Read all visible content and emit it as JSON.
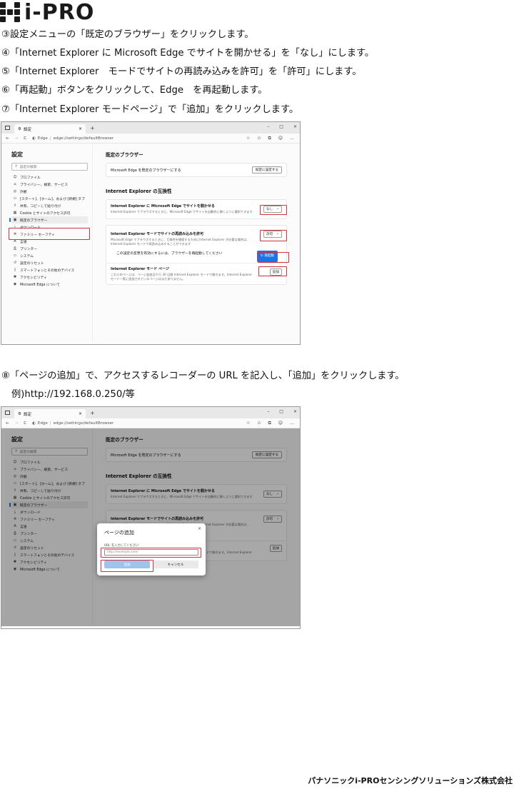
{
  "logo": {
    "text": "i-PRO"
  },
  "steps": {
    "s3": "③設定メニューの「既定のブラウザー」をクリックします。",
    "s4": "④「Internet Explorer に Microsoft Edge でサイトを開かせる」を「なし」にします。",
    "s5": "⑤「Internet Explorer　モードでサイトの再読み込みを許可」を「許可」にします。",
    "s6": "⑥「再起動」ボタンをクリックして、Edge　を再起動します。",
    "s7": "⑦「Internet Explorer モードページ」で「追加」をクリックします。",
    "s8": "⑧「ページの追加」で、アクセスするレコーダーの URL を記入し、「追加」をクリックします。",
    "example": "例)http://192.168.0.250/等"
  },
  "browser": {
    "tab_title": "設定",
    "tab_close": "×",
    "tab_plus": "+",
    "win_controls": [
      "–",
      "□",
      "×"
    ],
    "nav_back": "←",
    "nav_forward": "→",
    "nav_reload": "C",
    "edge_label": "Edge",
    "address_sep": "|",
    "address": "edge://settings/defaultBrowser",
    "toolbar_icons": [
      "☆",
      "✩",
      "⧉",
      "☺",
      "…"
    ]
  },
  "settings": {
    "sidebar_title": "設定",
    "search_placeholder": "設定の検索",
    "nav": [
      {
        "icon": "☺",
        "label": "プロファイル"
      },
      {
        "icon": "⌂",
        "label": "プライバシー、検索、サービス"
      },
      {
        "icon": "◎",
        "label": "外観"
      },
      {
        "icon": "▭",
        "label": "[スタート]、[ホーム]、および [新規] タブ"
      },
      {
        "icon": "⇪",
        "label": "共有、コピーして貼り付け"
      },
      {
        "icon": "▦",
        "label": "Cookie とサイトのアクセス許可"
      },
      {
        "icon": "▣",
        "label": "既定のブラウザー"
      },
      {
        "icon": "⤓",
        "label": "ダウンロード"
      },
      {
        "icon": "✲",
        "label": "ファミリー セーフティ"
      },
      {
        "icon": "A",
        "label": "言語"
      },
      {
        "icon": "⎙",
        "label": "プリンター"
      },
      {
        "icon": "▭",
        "label": "システム"
      },
      {
        "icon": "↺",
        "label": "設定のリセット"
      },
      {
        "icon": "▯",
        "label": "スマートフォンとその他のデバイス"
      },
      {
        "icon": "✱",
        "label": "アクセシビリティ"
      },
      {
        "icon": "◉",
        "label": "Microsoft Edge について"
      }
    ],
    "default_browser_heading": "既定のブラウザー",
    "make_default_text": "Microsoft Edge を既定のブラウザーにする",
    "make_default_button": "既定に設定する",
    "compat_heading": "Internet Explorer の互換性",
    "open_in_edge_title": "Internet Explorer に Microsoft Edge でサイトを開かせる",
    "open_in_edge_desc": "Internet Explorer でブラウズするときに、Microsoft Edge でサイトを自動的に開くように選択できます",
    "open_in_edge_value": "なし",
    "reload_ie_title": "Internet Explorer モードでサイトの再読み込みを許可",
    "reload_ie_desc": "Microsoft Edge でブラウズするときに、互換性を確保するためにInternet Explorer が必要な場合は、Internet Explorer モードで再読み込みすることができます",
    "reload_ie_value": "許可",
    "restart_note": "この設定の変更を有効にするには、ブラウザーを再起動してください",
    "restart_button": "再起動",
    "ie_pages_title": "Internet Explorer モード ページ",
    "ie_pages_desc": "これらのページは、ページ追加日から 30 日間 Internet Explorer モードで開きます。Internet Explorer モード一覧に追加されているページはまだありません。",
    "ie_pages_add": "追加"
  },
  "dialog": {
    "title": "ページの追加",
    "close": "×",
    "url_label": "URL を入力してください",
    "url_placeholder": "http://example.com/",
    "add_button": "追加",
    "cancel_button": "キャンセル"
  },
  "footer": "パナソニックi-PROセンシングソリューションズ株式会社",
  "colors": {
    "accent": "#1a73e8",
    "highlight": "#d3333f"
  }
}
